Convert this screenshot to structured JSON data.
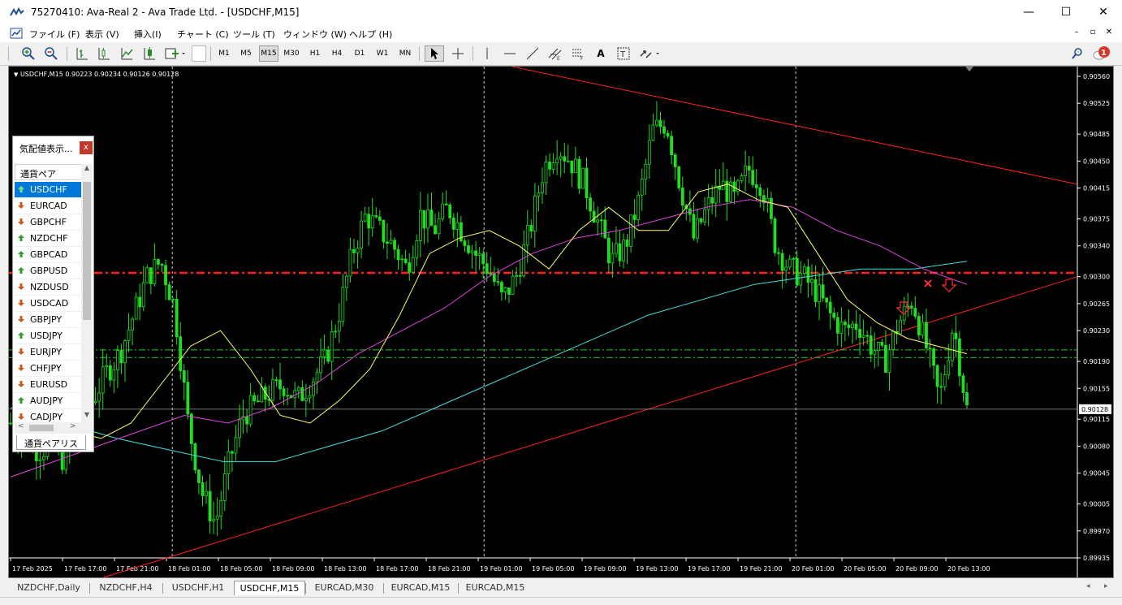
{
  "window": {
    "title": "75270410: Ava-Real 2 - Ava Trade Ltd. - [USDCHF,M15]",
    "minimize": "—",
    "maximize": "☐",
    "close": "✕"
  },
  "menu": {
    "items": [
      "ファイル (F)",
      "表示 (V)",
      "挿入(I)",
      "チャート (C)",
      "ツール (T)",
      "ウィンドウ (W)",
      "ヘルプ (H)"
    ]
  },
  "toolbar": {
    "timeframes": [
      "M1",
      "M5",
      "M15",
      "M30",
      "H1",
      "H4",
      "D1",
      "W1",
      "MN"
    ],
    "active_timeframe": "M15",
    "notification_count": "1"
  },
  "chart": {
    "header": "USDCHF,M15  0.90223 0.90234 0.90126 0.90128",
    "current_price": "0.90128"
  },
  "chart_data": {
    "type": "line",
    "symbol": "USDCHF",
    "timeframe": "M15",
    "ohlc_header": {
      "open": 0.90223,
      "high": 0.90234,
      "low": 0.90126,
      "close": 0.90128
    },
    "price_ticks": [
      "0.90560",
      "0.90525",
      "0.90485",
      "0.90450",
      "0.90415",
      "0.90375",
      "0.90340",
      "0.90300",
      "0.90265",
      "0.90230",
      "0.90190",
      "0.90155",
      "0.90115",
      "0.90080",
      "0.90045",
      "0.90005",
      "0.89970",
      "0.89935"
    ],
    "time_ticks": [
      "17 Feb 2025",
      "17 Feb 17:00",
      "17 Feb 21:00",
      "18 Feb 01:00",
      "18 Feb 05:00",
      "18 Feb 09:00",
      "18 Feb 13:00",
      "18 Feb 17:00",
      "18 Feb 21:00",
      "19 Feb 01:00",
      "19 Feb 05:00",
      "19 Feb 09:00",
      "19 Feb 13:00",
      "19 Feb 17:00",
      "19 Feb 21:00",
      "20 Feb 01:00",
      "20 Feb 05:00",
      "20 Feb 09:00",
      "20 Feb 13:00"
    ],
    "ylim": [
      0.89935,
      0.9056
    ],
    "close_path": [
      0.9011,
      0.9009,
      0.90075,
      0.9008,
      0.9006,
      0.9011,
      0.9014,
      0.90175,
      0.902,
      0.9025,
      0.903,
      0.9032,
      0.9026,
      0.9011,
      0.9002,
      0.8998,
      0.9006,
      0.9012,
      0.90135,
      0.9015,
      0.9016,
      0.9014,
      0.90165,
      0.9019,
      0.9025,
      0.9033,
      0.9038,
      0.9036,
      0.9034,
      0.9031,
      0.9038,
      0.9036,
      0.9039,
      0.9036,
      0.9033,
      0.9031,
      0.9027,
      0.903,
      0.9036,
      0.9044,
      0.9047,
      0.9045,
      0.9042,
      0.9037,
      0.9032,
      0.9034,
      0.904,
      0.9049,
      0.905,
      0.9042,
      0.9035,
      0.9039,
      0.9042,
      0.904,
      0.9044,
      0.9042,
      0.9034,
      0.9031,
      0.903,
      0.9028,
      0.9025,
      0.9023,
      0.9024,
      0.9021,
      0.9019,
      0.9024,
      0.9027,
      0.9021,
      0.9014,
      0.9024,
      0.90128
    ],
    "ma_fast": [
      0.9013,
      0.901,
      0.9009,
      0.9011,
      0.9016,
      0.9021,
      0.9023,
      0.9018,
      0.9012,
      0.9011,
      0.9014,
      0.9018,
      0.9025,
      0.9033,
      0.9035,
      0.9036,
      0.9034,
      0.9031,
      0.9036,
      0.9039,
      0.9036,
      0.9036,
      0.9041,
      0.9042,
      0.904,
      0.9039,
      0.9033,
      0.9027,
      0.9024,
      0.9022,
      0.9021,
      0.902
    ],
    "ma_mid": [
      0.9004,
      0.9006,
      0.9008,
      0.901,
      0.9012,
      0.9011,
      0.9013,
      0.9016,
      0.902,
      0.9023,
      0.9026,
      0.903,
      0.9033,
      0.9035,
      0.9036,
      0.90375,
      0.9039,
      0.904,
      0.9039,
      0.9036,
      0.9034,
      0.9031,
      0.9029
    ],
    "ma_slow": [
      0.9013,
      0.9011,
      0.9009,
      0.90075,
      0.9006,
      0.9006,
      0.9008,
      0.901,
      0.9013,
      0.9016,
      0.9019,
      0.9022,
      0.9025,
      0.9027,
      0.9029,
      0.903,
      0.9031,
      0.9031,
      0.9032
    ],
    "hlines": [
      {
        "price": 0.90305,
        "color": "#ff2020",
        "style": "dash-dot"
      },
      {
        "price": 0.90205,
        "color": "#22cc22",
        "style": "dash-dot"
      },
      {
        "price": 0.90195,
        "color": "#22cc22",
        "style": "dash-dot"
      },
      {
        "price": 0.90128,
        "color": "#a0a0a0",
        "style": "solid"
      }
    ],
    "trendlines": [
      {
        "from": [
          "18 Feb 05:00",
          0.8996
        ],
        "to": [
          "20 Feb 17:00",
          0.903
        ],
        "color": "#ff2020"
      },
      {
        "from": [
          "18 Feb 21:00",
          0.90585
        ],
        "to": [
          "20 Feb 17:00",
          0.9043
        ],
        "color": "#ff2020"
      }
    ],
    "colors": {
      "background": "#000000",
      "candles": "#22dd22",
      "ma_fast": "#ffff66",
      "ma_mid": "#dd44dd",
      "ma_slow": "#44dddd",
      "trendline": "#ff2020"
    }
  },
  "market_watch": {
    "title": "気配値表示...",
    "close_label": "x",
    "column_header": "通貨ペア",
    "symbols": [
      {
        "name": "USDCHF",
        "dir": "up",
        "selected": true
      },
      {
        "name": "EURCAD",
        "dir": "down"
      },
      {
        "name": "GBPCHF",
        "dir": "down"
      },
      {
        "name": "NZDCHF",
        "dir": "up"
      },
      {
        "name": "GBPCAD",
        "dir": "up"
      },
      {
        "name": "GBPUSD",
        "dir": "up"
      },
      {
        "name": "NZDUSD",
        "dir": "down"
      },
      {
        "name": "USDCAD",
        "dir": "down"
      },
      {
        "name": "GBPJPY",
        "dir": "down"
      },
      {
        "name": "USDJPY",
        "dir": "up"
      },
      {
        "name": "EURJPY",
        "dir": "down"
      },
      {
        "name": "CHFJPY",
        "dir": "down"
      },
      {
        "name": "EURUSD",
        "dir": "down"
      },
      {
        "name": "AUDJPY",
        "dir": "up"
      },
      {
        "name": "CADJPY",
        "dir": "down"
      }
    ],
    "tab_label": "通貨ペアリスト"
  },
  "chart_tabs": [
    "NZDCHF,Daily",
    "NZDCHF,H4",
    "USDCHF,H1",
    "USDCHF,M15",
    "EURCAD,M30",
    "EURCAD,M15",
    "EURCAD,M15"
  ],
  "active_chart_tab": "USDCHF,M15"
}
